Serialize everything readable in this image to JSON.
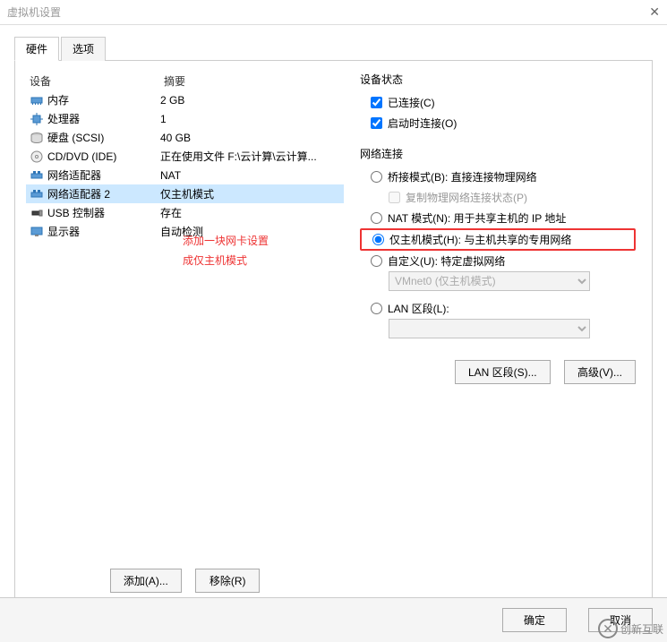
{
  "window": {
    "title": "虚拟机设置"
  },
  "tabs": {
    "hardware": "硬件",
    "options": "选项"
  },
  "listHeader": {
    "device": "设备",
    "summary": "摘要"
  },
  "devices": [
    {
      "icon": "memory",
      "name": "内存",
      "summary": "2 GB"
    },
    {
      "icon": "cpu",
      "name": "处理器",
      "summary": "1"
    },
    {
      "icon": "disk",
      "name": "硬盘 (SCSI)",
      "summary": "40 GB"
    },
    {
      "icon": "cd",
      "name": "CD/DVD (IDE)",
      "summary": "正在使用文件 F:\\云计算\\云计算..."
    },
    {
      "icon": "net",
      "name": "网络适配器",
      "summary": "NAT"
    },
    {
      "icon": "net",
      "name": "网络适配器 2",
      "summary": "仅主机模式",
      "selected": true
    },
    {
      "icon": "usb",
      "name": "USB 控制器",
      "summary": "存在"
    },
    {
      "icon": "display",
      "name": "显示器",
      "summary": "自动检测"
    }
  ],
  "leftButtons": {
    "add": "添加(A)...",
    "remove": "移除(R)"
  },
  "deviceStatus": {
    "title": "设备状态",
    "connected": "已连接(C)",
    "connectAtPower": "启动时连接(O)"
  },
  "netConn": {
    "title": "网络连接",
    "bridged": "桥接模式(B): 直接连接物理网络",
    "replicate": "复制物理网络连接状态(P)",
    "nat": "NAT 模式(N): 用于共享主机的 IP 地址",
    "hostonly": "仅主机模式(H): 与主机共享的专用网络",
    "custom": "自定义(U): 特定虚拟网络",
    "customSelect": "VMnet0 (仅主机模式)",
    "lanSegment": "LAN 区段(L):",
    "lanSelect": ""
  },
  "rightButtons": {
    "lanSegments": "LAN 区段(S)...",
    "advanced": "高级(V)..."
  },
  "footer": {
    "ok": "确定",
    "cancel": "取消"
  },
  "annotation": {
    "line1": "添加一块网卡设置",
    "line2": "成仅主机模式"
  },
  "watermark": "创新互联"
}
